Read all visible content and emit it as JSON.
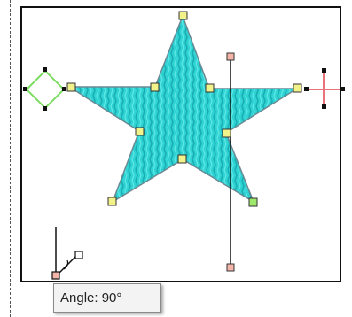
{
  "tooltip": {
    "text": "Angle: 90°"
  },
  "colors": {
    "star_fill": "#2fd3d3",
    "star_stitch_dark": "#18a9ad",
    "outline": "#4a6b7a",
    "handle_yellow": "#f2f28a",
    "handle_pink": "#f4b5a8",
    "diamond_green": "#7ddc63",
    "cross_red": "#e8737a",
    "frame": "#111111"
  },
  "icons": [
    "rotate-diamond-icon",
    "move-cross-icon",
    "angle-tool-icon"
  ]
}
